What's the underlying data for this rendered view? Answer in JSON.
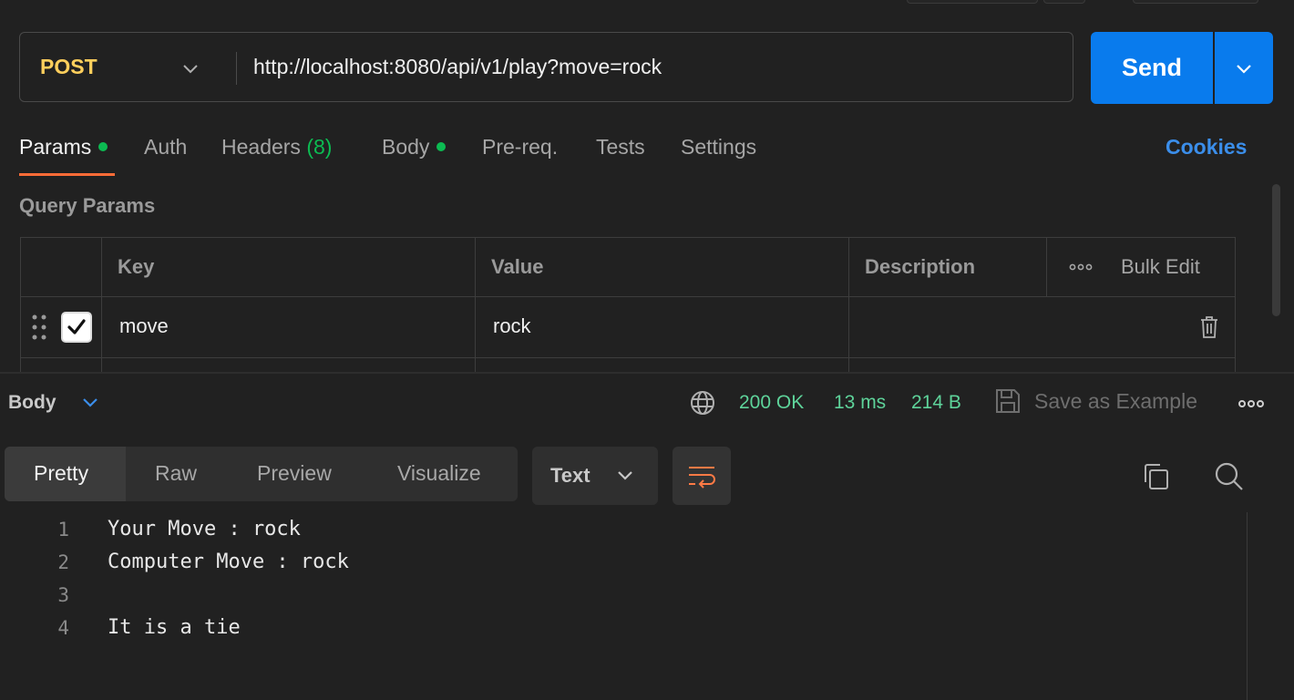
{
  "request": {
    "method": "POST",
    "url": "http://localhost:8080/api/v1/play?move=rock",
    "send_label": "Send"
  },
  "tabs": [
    {
      "label": "Params",
      "active": true,
      "dot": true
    },
    {
      "label": "Auth"
    },
    {
      "label": "Headers",
      "count": "(8)"
    },
    {
      "label": "Body",
      "dot": true
    },
    {
      "label": "Pre-req."
    },
    {
      "label": "Tests"
    },
    {
      "label": "Settings"
    }
  ],
  "cookies_label": "Cookies",
  "query_params": {
    "title": "Query Params",
    "columns": {
      "key": "Key",
      "value": "Value",
      "description": "Description"
    },
    "bulk_edit": "Bulk Edit",
    "rows": [
      {
        "checked": true,
        "key": "move",
        "value": "rock",
        "description": ""
      }
    ]
  },
  "response": {
    "section_label": "Body",
    "status": "200 OK",
    "time": "13 ms",
    "size": "214 B",
    "save_example": "Save as Example",
    "view_modes": [
      "Pretty",
      "Raw",
      "Preview",
      "Visualize"
    ],
    "active_view": "Pretty",
    "format": "Text",
    "lines": [
      {
        "n": "1",
        "text": "Your Move : rock"
      },
      {
        "n": "2",
        "text": "Computer Move : rock"
      },
      {
        "n": "3",
        "text": ""
      },
      {
        "n": "4",
        "text": "It is a tie"
      }
    ]
  },
  "colors": {
    "background": "#212121",
    "method": "#ffcf5c",
    "send": "#097bed",
    "accent_underline": "#ff6c37",
    "status_green": "#5ed39a",
    "dot_green": "#0cbb52",
    "cookies_blue": "#3b8eea"
  }
}
